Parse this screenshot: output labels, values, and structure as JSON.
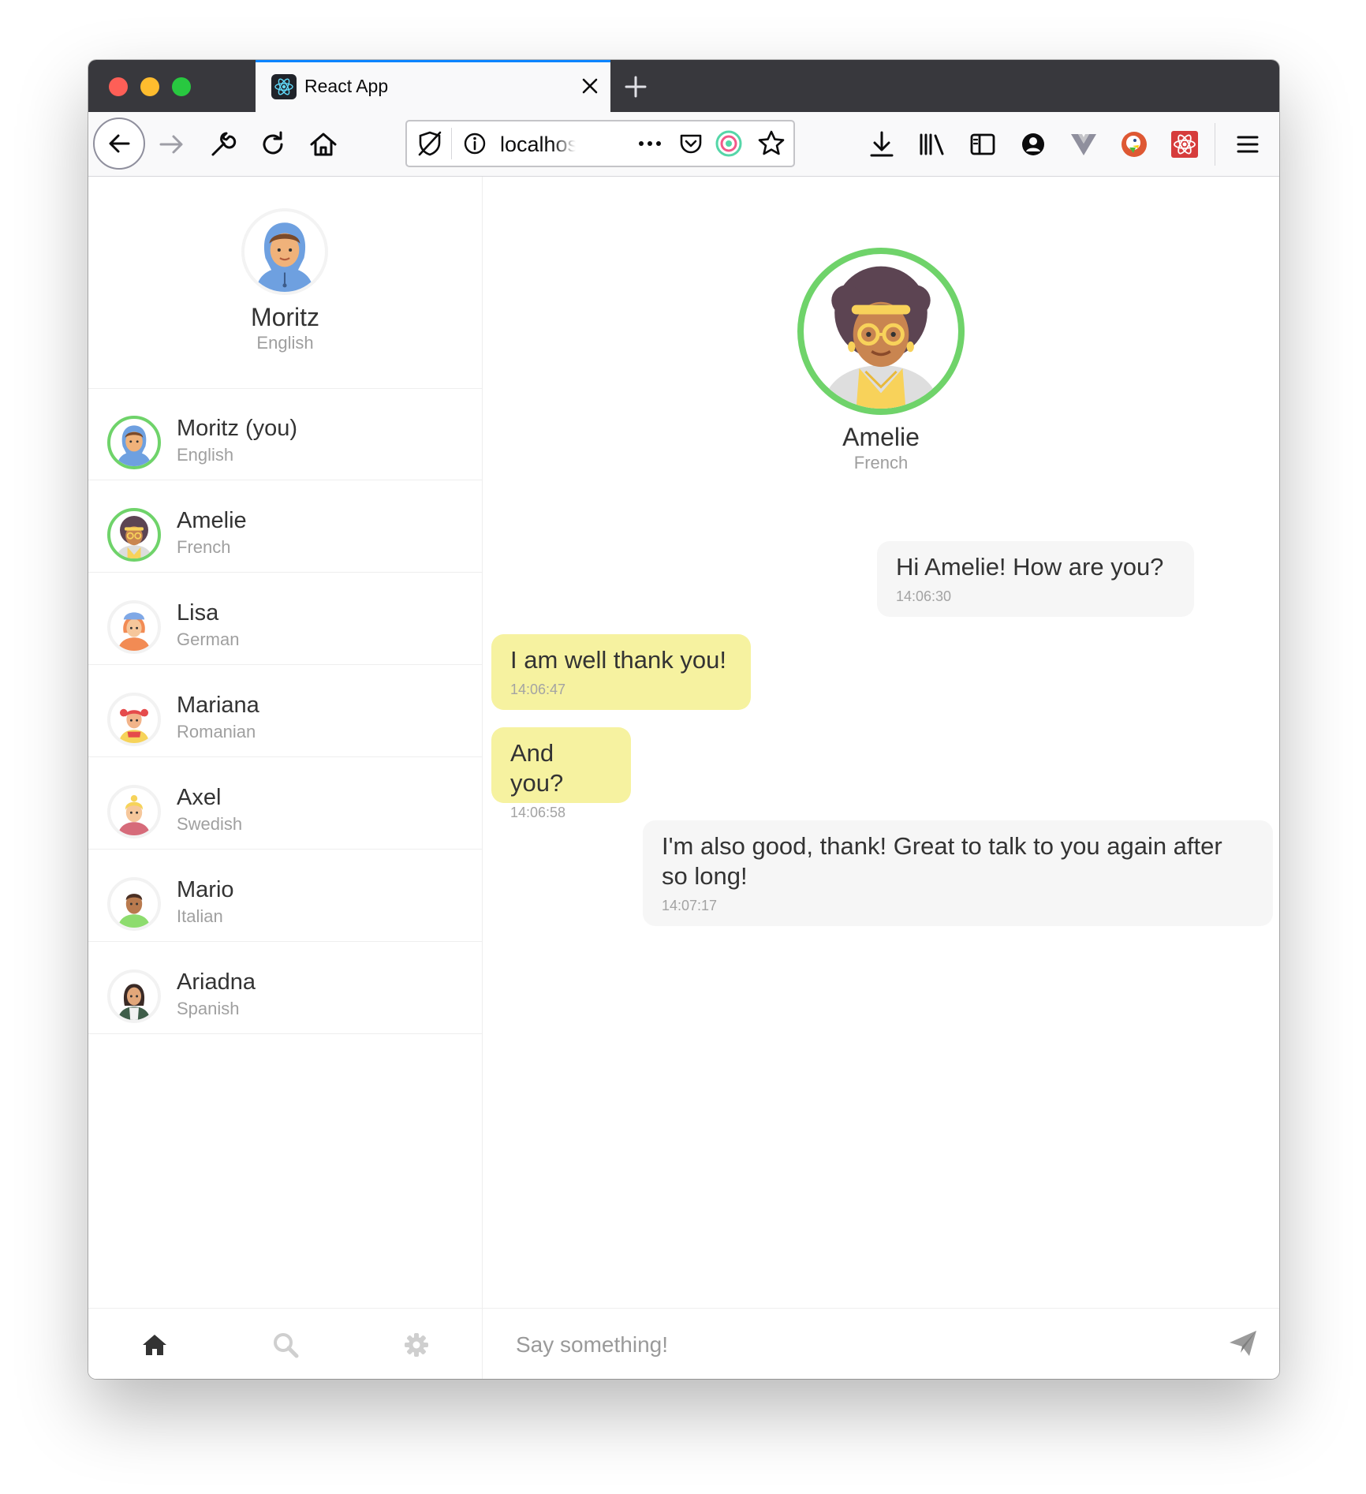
{
  "browser": {
    "tab_title": "React App",
    "url": "localhost"
  },
  "sidebar": {
    "profile": {
      "name": "Moritz",
      "language": "English"
    },
    "contacts": [
      {
        "name": "Moritz (you)",
        "language": "English",
        "online": true
      },
      {
        "name": "Amelie",
        "language": "French",
        "online": true
      },
      {
        "name": "Lisa",
        "language": "German",
        "online": false
      },
      {
        "name": "Mariana",
        "language": "Romanian",
        "online": false
      },
      {
        "name": "Axel",
        "language": "Swedish",
        "online": false
      },
      {
        "name": "Mario",
        "language": "Italian",
        "online": false
      },
      {
        "name": "Ariadna",
        "language": "Spanish",
        "online": false
      }
    ],
    "nav": [
      "home-icon",
      "search-icon",
      "gear-icon"
    ]
  },
  "chat": {
    "partner": {
      "name": "Amelie",
      "language": "French"
    },
    "messages": [
      {
        "text": "Hi Amelie! How are you?",
        "time": "14:06:30",
        "direction": "outgoing"
      },
      {
        "text": "I am well thank you!",
        "time": "14:06:47",
        "direction": "incoming"
      },
      {
        "text": "And you?",
        "time": "14:06:58",
        "direction": "incoming"
      },
      {
        "text": "I'm also good, thank! Great to talk to you again after so long!",
        "time": "14:07:17",
        "direction": "outgoing"
      }
    ],
    "composer": {
      "placeholder": "Say something!",
      "value": ""
    }
  },
  "colors": {
    "online_ring": "#6fd36a",
    "incoming_bubble": "#f6f2a0",
    "outgoing_bubble": "#f6f6f6",
    "titlebar": "#38383d",
    "active_tab_accent": "#0a84ff"
  }
}
